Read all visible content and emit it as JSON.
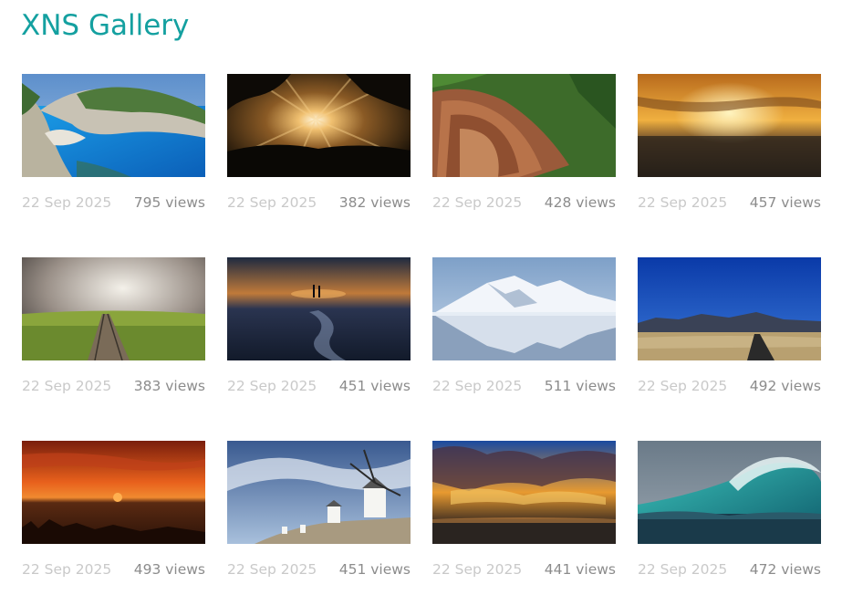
{
  "header": {
    "title": "XNS Gallery"
  },
  "gallery": {
    "items": [
      {
        "image": "navagio-beach-cove",
        "date": "22 Sep 2025",
        "views": "795 views"
      },
      {
        "image": "sunburst-through-trees",
        "date": "22 Sep 2025",
        "views": "382 views"
      },
      {
        "image": "terraced-fields-aerial",
        "date": "22 Sep 2025",
        "views": "428 views"
      },
      {
        "image": "golden-sunset-sea",
        "date": "22 Sep 2025",
        "views": "457 views"
      },
      {
        "image": "railway-under-clouds",
        "date": "22 Sep 2025",
        "views": "383 views"
      },
      {
        "image": "couple-on-beach-dusk",
        "date": "22 Sep 2025",
        "views": "451 views"
      },
      {
        "image": "snowy-mountain-reflection",
        "date": "22 Sep 2025",
        "views": "511 views"
      },
      {
        "image": "desert-road-mountains",
        "date": "22 Sep 2025",
        "views": "492 views"
      },
      {
        "image": "orange-sunset-lake",
        "date": "22 Sep 2025",
        "views": "493 views"
      },
      {
        "image": "windmills-on-hill",
        "date": "22 Sep 2025",
        "views": "451 views"
      },
      {
        "image": "dramatic-sunset-clouds",
        "date": "22 Sep 2025",
        "views": "441 views"
      },
      {
        "image": "ocean-wave-curl",
        "date": "22 Sep 2025",
        "views": "472 views"
      }
    ]
  }
}
